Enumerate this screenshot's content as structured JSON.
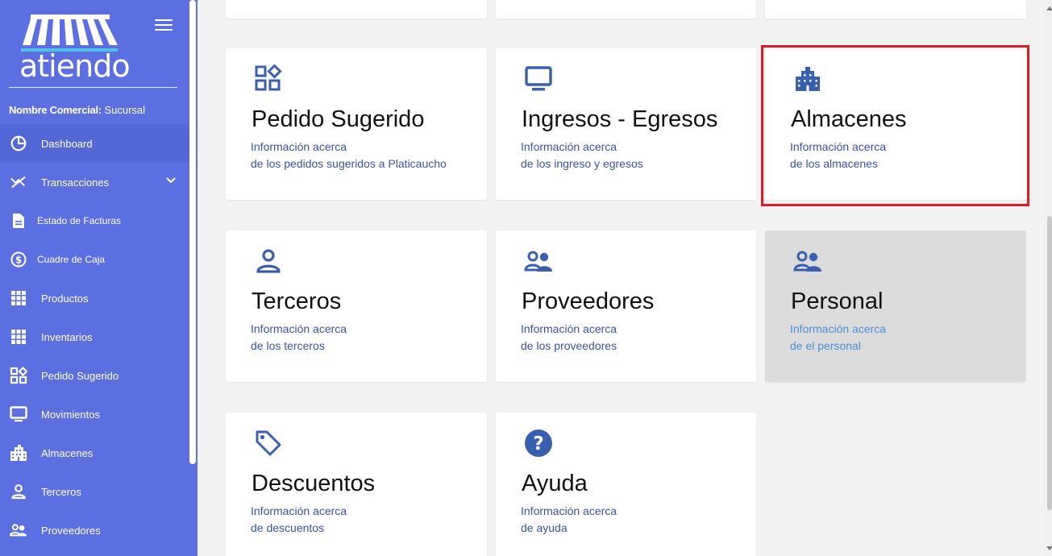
{
  "app": {
    "logo_text": "atiendo"
  },
  "business": {
    "label": "Nombre Comercial:",
    "value": "Sucursal"
  },
  "sidebar": {
    "items": [
      {
        "label": "Dashboard",
        "icon": "dashboard-icon"
      },
      {
        "label": "Transacciones",
        "icon": "transactions-icon"
      },
      {
        "label": "Estado de Facturas",
        "icon": "invoice-icon"
      },
      {
        "label": "Cuadre de Caja",
        "icon": "cash-icon"
      },
      {
        "label": "Productos",
        "icon": "grid-icon"
      },
      {
        "label": "Inventarios",
        "icon": "grid-icon"
      },
      {
        "label": "Pedido Sugerido",
        "icon": "widgets-icon"
      },
      {
        "label": "Movimientos",
        "icon": "monitor-icon"
      },
      {
        "label": "Almacenes",
        "icon": "building-icon"
      },
      {
        "label": "Terceros",
        "icon": "person-icon"
      },
      {
        "label": "Proveedores",
        "icon": "people-icon"
      }
    ]
  },
  "cards": [
    {
      "title": "Pedido Sugerido",
      "line1": "Información acerca",
      "line2": "de los pedidos sugeridos a Platicaucho",
      "icon": "widgets-icon"
    },
    {
      "title": "Ingresos - Egresos",
      "line1": "Información acerca",
      "line2": "de los ingreso y egresos",
      "icon": "monitor-icon"
    },
    {
      "title": "Almacenes",
      "line1": "Información acerca",
      "line2": "de los almacenes",
      "icon": "building-icon"
    },
    {
      "title": "Terceros",
      "line1": "Información acerca",
      "line2": "de los terceros",
      "icon": "person-icon"
    },
    {
      "title": "Proveedores",
      "line1": "Información acerca",
      "line2": "de los proveedores",
      "icon": "people-icon"
    },
    {
      "title": "Personal",
      "line1": "Información acerca",
      "line2": "de el personal",
      "icon": "people-icon"
    },
    {
      "title": "Descuentos",
      "line1": "Información acerca",
      "line2": "de descuentos",
      "icon": "tag-icon"
    },
    {
      "title": "Ayuda",
      "line1": "Información acerca",
      "line2": "de ayuda",
      "icon": "help-icon"
    }
  ],
  "colors": {
    "sidebar": "#5b6fe0",
    "accent_icon": "#3a5fb0",
    "highlight": "#e01b24",
    "link_text": "#3a53a4"
  }
}
